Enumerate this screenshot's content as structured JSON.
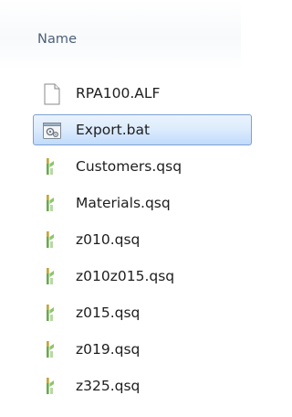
{
  "header": {
    "column_name": "Name"
  },
  "files": [
    {
      "name": "RPA100.ALF",
      "icon": "blank-document-icon",
      "selected": false
    },
    {
      "name": "Export.bat",
      "icon": "batch-file-icon",
      "selected": true
    },
    {
      "name": "Customers.qsq",
      "icon": "query-file-icon",
      "selected": false
    },
    {
      "name": "Materials.qsq",
      "icon": "query-file-icon",
      "selected": false
    },
    {
      "name": "z010.qsq",
      "icon": "query-file-icon",
      "selected": false
    },
    {
      "name": "z010z015.qsq",
      "icon": "query-file-icon",
      "selected": false
    },
    {
      "name": "z015.qsq",
      "icon": "query-file-icon",
      "selected": false
    },
    {
      "name": "z019.qsq",
      "icon": "query-file-icon",
      "selected": false
    },
    {
      "name": "z325.qsq",
      "icon": "query-file-icon",
      "selected": false
    }
  ],
  "colors": {
    "selection_border": "#7da2ce",
    "selection_fill": "#dcebfc",
    "header_text": "#4c607a",
    "query_icon_green": "#6aa84f"
  }
}
